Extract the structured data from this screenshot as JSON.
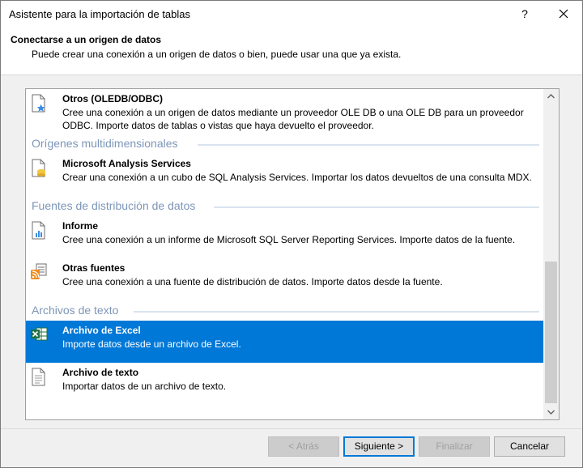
{
  "window": {
    "title": "Asistente para la importación de tablas",
    "help_label": "?"
  },
  "header": {
    "title": "Conectarse a un origen de datos",
    "subtitle": "Puede crear una conexión a un origen de datos o bien, puede usar una que ya exista."
  },
  "list": {
    "items": [
      {
        "name": "Otros (OLEDB/ODBC)",
        "description": "Cree una conexión a un origen de datos mediante un proveedor OLE DB o una OLE DB para un proveedor ODBC. Importe datos de tablas o vistas que haya devuelto el proveedor.",
        "icon": "oledb-icon"
      },
      {
        "group": "Orígenes multidimensionales"
      },
      {
        "name": "Microsoft Analysis Services",
        "description": "Crear una conexión a un cubo de SQL Analysis Services. Importar los datos devueltos de una consulta MDX.",
        "icon": "analysis-services-icon"
      },
      {
        "group": "Fuentes de distribución de datos"
      },
      {
        "name": "Informe",
        "description": "Cree una conexión a un informe de Microsoft SQL Server Reporting Services. Importe datos de la fuente.",
        "icon": "report-icon"
      },
      {
        "name": "Otras fuentes",
        "description": "Cree una conexión a una fuente de distribución de datos. Importe datos desde la fuente.",
        "icon": "data-feed-icon"
      },
      {
        "group": "Archivos de texto"
      },
      {
        "name": "Archivo de Excel",
        "description": "Importe datos desde un archivo de Excel.",
        "icon": "excel-icon",
        "selected": true
      },
      {
        "name": "Archivo de texto",
        "description": "Importar datos de un archivo de texto.",
        "icon": "text-file-icon"
      }
    ]
  },
  "footer": {
    "back_label": "< Atrás",
    "next_label": "Siguiente >",
    "finish_label": "Finalizar",
    "cancel_label": "Cancelar"
  },
  "colors": {
    "selection": "#0078d7",
    "group_title": "#7d96b8"
  }
}
